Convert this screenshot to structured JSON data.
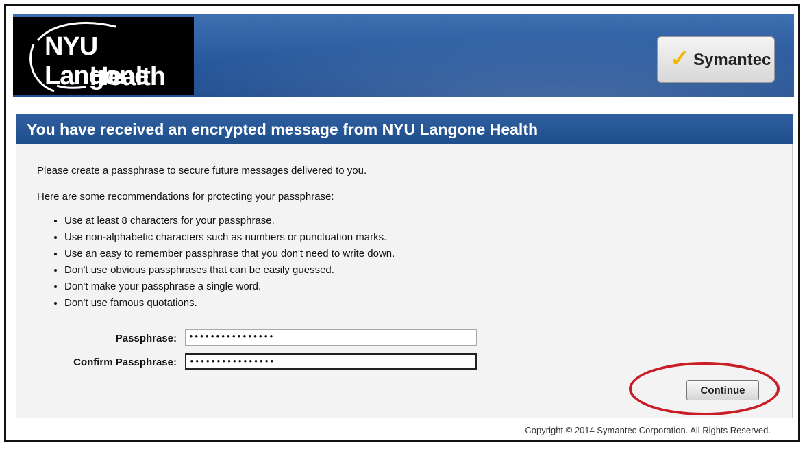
{
  "header": {
    "logo_line1": "NYU Langone",
    "logo_line2": "Health",
    "badge_text": "Symantec"
  },
  "message": {
    "title": "You have received an encrypted message from NYU Langone Health",
    "intro": "Please create a passphrase to secure future messages delivered to you.",
    "recommendations_intro": "Here are some recommendations for protecting your passphrase:",
    "recommendations": [
      "Use at least 8 characters for your passphrase.",
      "Use non-alphabetic characters such as numbers or punctuation marks.",
      "Use an easy to remember passphrase that you don't need to write down.",
      "Don't use obvious passphrases that can be easily guessed.",
      "Don't make your passphrase a single word.",
      "Don't use famous quotations."
    ]
  },
  "form": {
    "passphrase_label": "Passphrase:",
    "passphrase_value": "••••••••••••••••",
    "confirm_label": "Confirm Passphrase:",
    "confirm_value": "••••••••••••••••",
    "continue_label": "Continue"
  },
  "footer": {
    "copyright": "Copyright © 2014 Symantec Corporation. All Rights Reserved."
  },
  "colors": {
    "header_blue": "#2a5a9e",
    "title_blue": "#1f4e8c",
    "highlight_red": "#c81d25",
    "check_yellow": "#f2b705"
  }
}
